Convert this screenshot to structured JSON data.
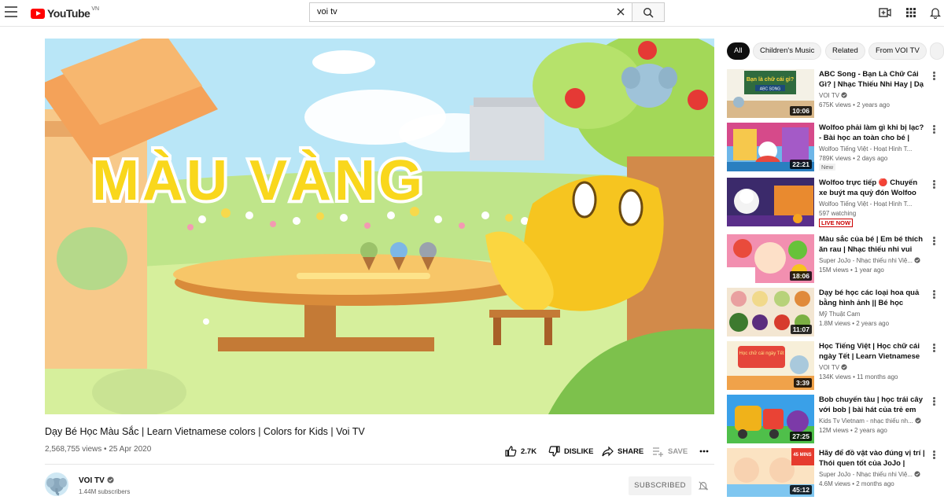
{
  "header": {
    "logo_text": "YouTube",
    "logo_country": "VN",
    "search_value": "voi tv",
    "icons": [
      "menu-icon",
      "search-icon",
      "create-video-icon",
      "apps-grid-icon",
      "notifications-bell-icon"
    ]
  },
  "player": {
    "overlay_text": "MÀU VÀNG"
  },
  "video": {
    "title": "Dạy Bé Học Màu Sắc | Learn Vietnamese colors | Colors for Kids | Voi TV",
    "views": "2,568,755 views",
    "date": "25 Apr 2020",
    "meta": "2,568,755 views • 25 Apr 2020",
    "likes": "2.7K",
    "dislike_label": "DISLIKE",
    "share_label": "SHARE",
    "save_label": "SAVE"
  },
  "channel": {
    "name": "VOI TV",
    "subscribers": "1.44M subscribers",
    "subscribe_label": "SUBSCRIBED"
  },
  "chips": [
    "All",
    "Children's Music",
    "Related",
    "From VOI TV"
  ],
  "recommendations": [
    {
      "title": "ABC Song - Bạn Là Chữ Cái Gì? | Nhạc Thiếu Nhi Hay | Dạ Bé Họ...",
      "channel": "VOI TV",
      "verified": true,
      "meta": "675K views • 2 years ago",
      "duration": "10:06",
      "badge": ""
    },
    {
      "title": "Wolfoo phải làm gì khi bị lạc? - Bài học an toàn cho bé | Phim...",
      "channel": "Wolfoo Tiếng Việt - Hoạt Hình T...",
      "verified": false,
      "meta": "789K views • 2 days ago",
      "duration": "22:21",
      "badge": "New"
    },
    {
      "title": "Wolfoo trực tiếp 🔴 Chuyến xe buýt ma quỷ đón Wolfoo trong...",
      "channel": "Wolfoo Tiếng Việt - Hoạt Hình T...",
      "verified": false,
      "meta": "597 watching",
      "duration": "",
      "badge": "",
      "live": "LIVE NOW"
    },
    {
      "title": "Màu sắc của bé | Em bé thích ăn rau | Nhạc thiếu nhi vui nhộn |...",
      "channel": "Super JoJo - Nhạc thiếu nhi Việ...",
      "verified": true,
      "meta": "15M views • 1 year ago",
      "duration": "18:06",
      "badge": ""
    },
    {
      "title": "Dạy bé học các loại hoa quả bằng hình ảnh || Bé học online...",
      "channel": "Mỹ Thuật Cam",
      "verified": false,
      "meta": "1.8M views • 2 years ago",
      "duration": "11:07",
      "badge": ""
    },
    {
      "title": "Học Tiếng Việt | Học chữ cái ngày Tết | Learn Vietnamese |...",
      "channel": "VOI TV",
      "verified": true,
      "meta": "134K views • 11 months ago",
      "duration": "3:39",
      "badge": ""
    },
    {
      "title": "Bob chuyến tàu | học trái cây với bob | bài hát của trẻ em biên...",
      "channel": "Kids Tv Vietnam - nhạc thiếu nh...",
      "verified": true,
      "meta": "12M views • 2 years ago",
      "duration": "27:25",
      "badge": ""
    },
    {
      "title": "Hãy để đồ vật vào đúng vị trí | Thói quen tốt của JoJo | Nhạc...",
      "channel": "Super JoJo - Nhạc thiếu nhi Việ...",
      "verified": true,
      "meta": "4.6M views • 2 months ago",
      "duration": "45:12",
      "badge": ""
    }
  ],
  "thumb_text": [
    "Bạn là chữ cái gì?",
    "ABC SONG",
    "Học chữ cái ngày Tết",
    "45 MINS"
  ],
  "colors": {
    "brand_red": "#ff0000",
    "text_primary": "#0f0f0f",
    "text_secondary": "#606060",
    "live_red": "#cc0000"
  }
}
